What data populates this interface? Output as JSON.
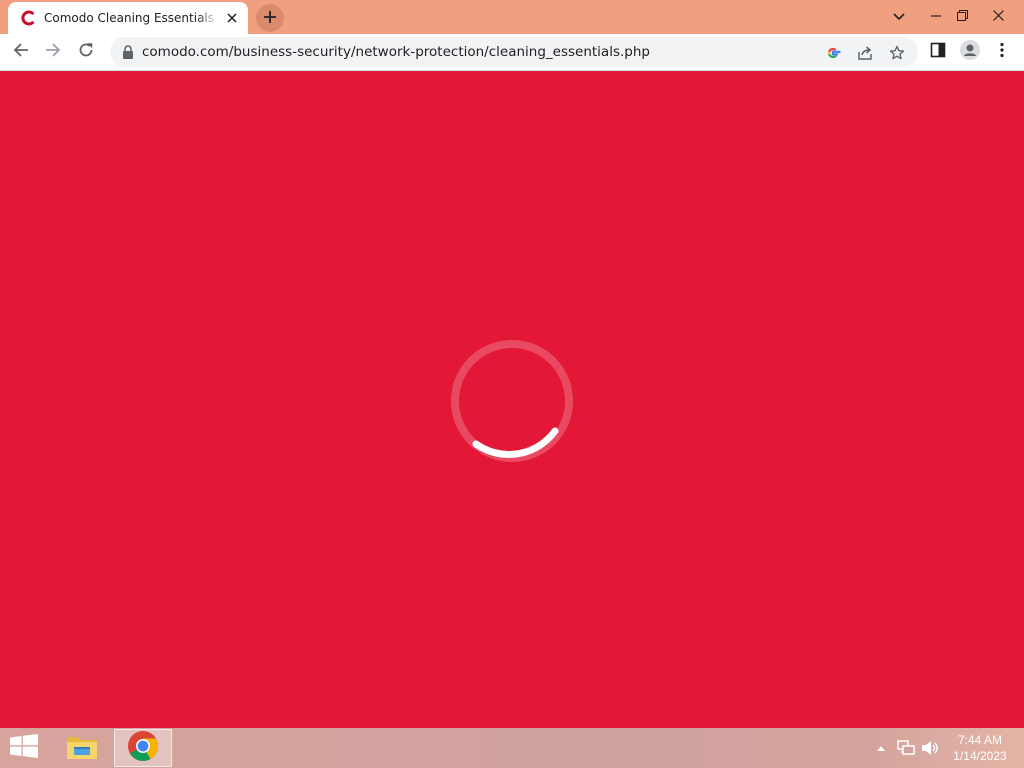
{
  "browser": {
    "tab": {
      "title": "Comodo Cleaning Essentials | Do",
      "favicon": "comodo-c-icon",
      "close_icon": "close-icon"
    },
    "new_tab_icon": "plus-icon",
    "window_controls": [
      "chevron-down-icon",
      "minimize-icon",
      "restore-icon",
      "close-icon"
    ],
    "toolbar": {
      "back_icon": "arrow-left-icon",
      "forward_icon": "arrow-right-icon",
      "reload_icon": "reload-icon",
      "address_bar": {
        "url": "comodo.com/business-security/network-protection/cleaning_essentials.php",
        "lock_icon": "lock-icon",
        "right_icons": [
          "google-icon",
          "share-icon",
          "star-icon"
        ]
      },
      "side_panel_icon": "side-panel-icon",
      "profile_icon": "profile-icon",
      "menu_icon": "kebab-menu-icon"
    }
  },
  "page": {
    "state": "loading",
    "background_color": "#e31837",
    "spinner_icon": "loading-spinner-icon"
  },
  "taskbar": {
    "start_icon": "windows-start-icon",
    "pinned": [
      "file-explorer-icon",
      "chrome-icon"
    ],
    "active": "chrome-icon",
    "tray": [
      "show-hidden-icons-chevron",
      "network-icon",
      "volume-icon"
    ],
    "clock": {
      "time": "7:44 AM",
      "date": "1/14/2023"
    }
  }
}
